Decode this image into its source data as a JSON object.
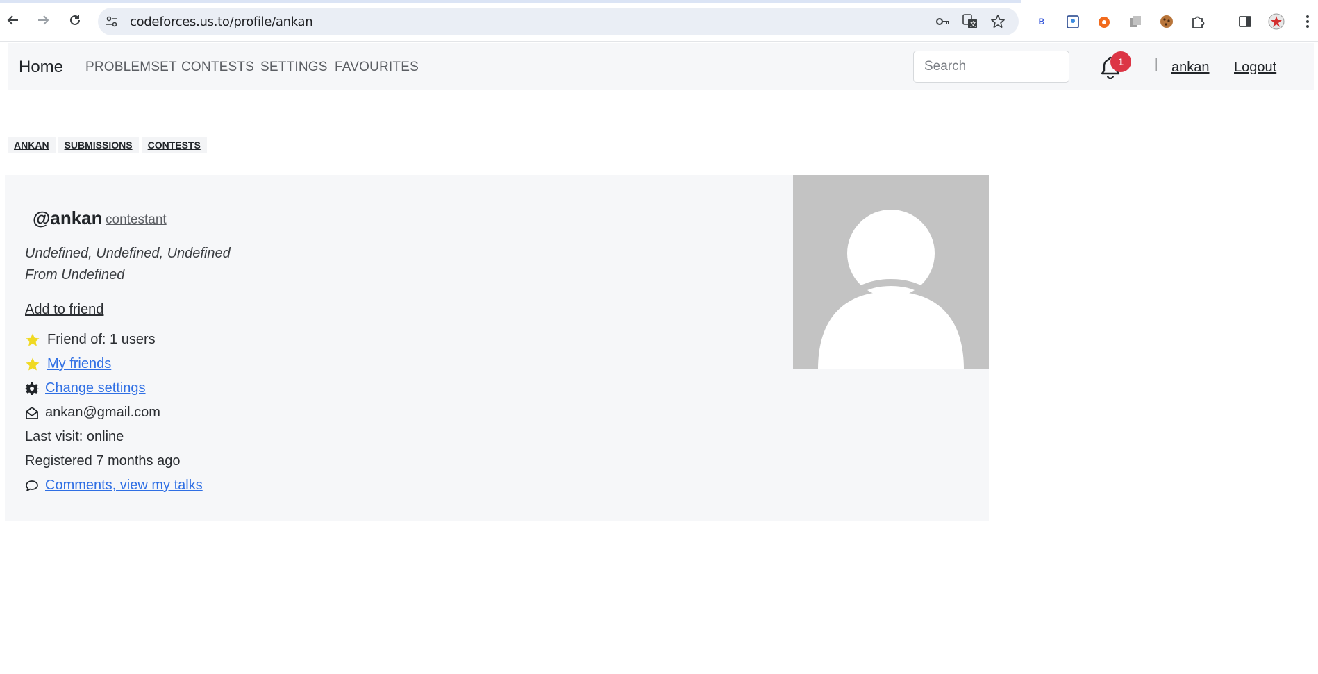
{
  "browser": {
    "url": "codeforces.us.to/profile/ankan"
  },
  "navbar": {
    "brand": "Home",
    "links": [
      "PROBLEMSET",
      "CONTESTS",
      "SETTINGS",
      "FAVOURITES"
    ],
    "search_placeholder": "Search",
    "notification_count": "1",
    "separator": "|",
    "username": "ankan",
    "logout": "Logout"
  },
  "tabs": [
    "ANKAN",
    "SUBMISSIONS",
    "CONTESTS"
  ],
  "profile": {
    "handle": "@ankan",
    "role": "contestant",
    "location_line": "Undefined, Undefined, Undefined",
    "from_line": "From Undefined",
    "add_friend": "Add to friend",
    "friend_of": "Friend of: 1 users",
    "my_friends": "My friends",
    "change_settings": "Change settings",
    "email": "ankan@gmail.com",
    "last_visit": "Last visit: online",
    "registered": "Registered 7 months ago",
    "comments": "Comments, view my talks"
  },
  "colors": {
    "accent_link": "#2f6fe4",
    "star": "#f0d922",
    "badge": "#dc3545",
    "card_bg": "#f6f7f9"
  }
}
